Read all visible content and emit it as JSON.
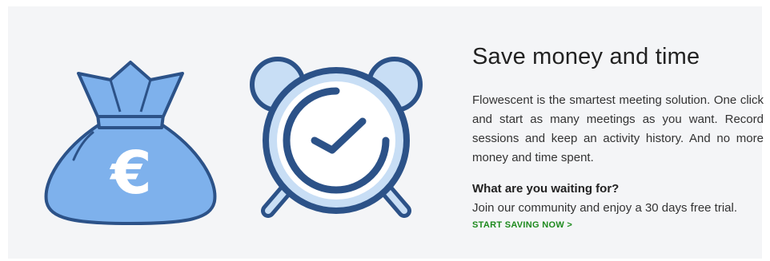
{
  "feature": {
    "title": "Save money and time",
    "description": "Flowescent is the smartest meeting solution. One click and start as many meetings as you want. Record sessions and keep an activity history. And no more money and time spent.",
    "question": "What are you waiting for?",
    "pitch": "Join our community and enjoy a 30 days free trial.",
    "cta_label": "START SAVING NOW >"
  },
  "illustrations": {
    "money_bag": {
      "icon": "money-bag-euro-icon",
      "glyph": "€"
    },
    "clock": {
      "icon": "alarm-clock-icon"
    }
  },
  "colors": {
    "panel_bg": "#f4f5f7",
    "illustration_outline": "#2c5288",
    "bag_fill": "#7eb1ec",
    "clock_fill": "#c8def5",
    "cta": "#1d8a1d"
  }
}
